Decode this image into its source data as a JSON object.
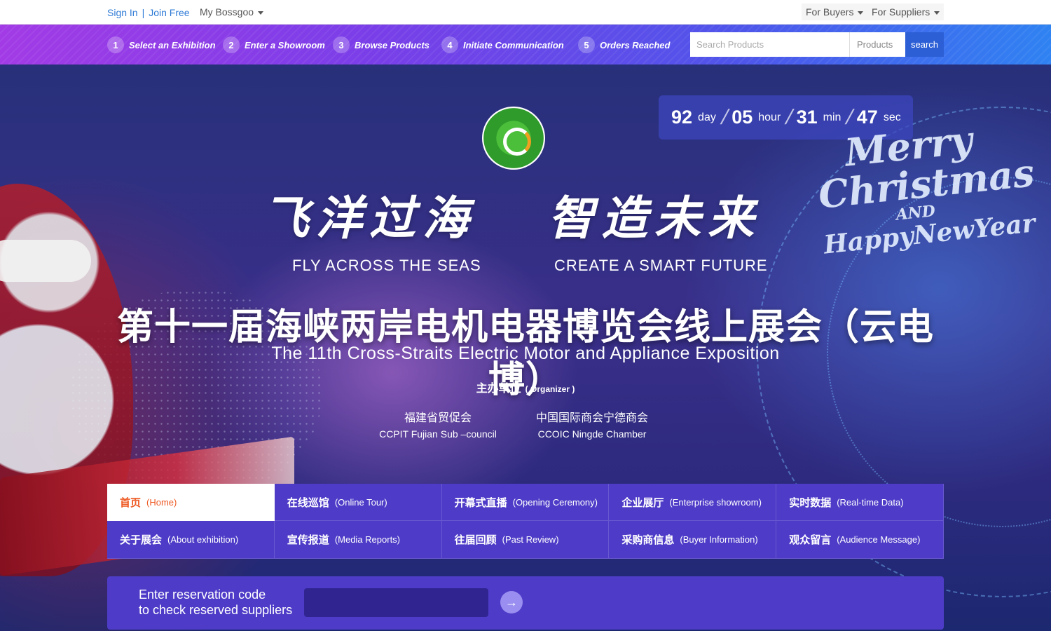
{
  "topbar": {
    "sign_in": "Sign In",
    "join_free": "Join Free",
    "my_bossgoo": "My Bossgoo",
    "for_buyers": "For Buyers",
    "for_suppliers": "For Suppliers"
  },
  "steps": [
    {
      "num": "1",
      "label": "Select an Exhibition"
    },
    {
      "num": "2",
      "label": "Enter a Showroom"
    },
    {
      "num": "3",
      "label": "Browse Products"
    },
    {
      "num": "4",
      "label": "Initiate Communication"
    },
    {
      "num": "5",
      "label": "Orders Reached"
    }
  ],
  "search": {
    "placeholder": "Search Products",
    "category": "Products",
    "button": "search"
  },
  "countdown": {
    "day": "92",
    "day_unit": "day",
    "hour": "05",
    "hour_unit": "hour",
    "min": "31",
    "min_unit": "min",
    "sec": "47",
    "sec_unit": "sec"
  },
  "hero": {
    "slogan_left_cn": "飞洋过海",
    "slogan_right_cn": "智造未来",
    "slogan_left_en": "FLY ACROSS THE SEAS",
    "slogan_right_en": "CREATE A SMART FUTURE",
    "merry_line1": "Merry Christmas",
    "merry_line2": "AND",
    "merry_line3": "HappyNewYear",
    "title_cn": "第十一届海峡两岸电机电器博览会线上展会（云电博）",
    "title_en": "The 11th Cross-Straits Electric Motor and Appliance Exposition",
    "organizer_cn": "主办单位",
    "organizer_en": "( Organizer )",
    "org1_cn": "福建省贸促会",
    "org1_en": "CCPIT Fujian Sub –council",
    "org2_cn": "中国国际商会宁德商会",
    "org2_en": "CCOIC Ningde Chamber"
  },
  "nav": [
    {
      "cn": "首页",
      "en": "(Home)"
    },
    {
      "cn": "在线巡馆",
      "en": "(Online Tour)"
    },
    {
      "cn": "开幕式直播",
      "en": "(Opening Ceremony)"
    },
    {
      "cn": "企业展厅",
      "en": "(Enterprise showroom)"
    },
    {
      "cn": "实时数据",
      "en": "(Real-time Data)"
    },
    {
      "cn": "关于展会",
      "en": "(About exhibition)"
    },
    {
      "cn": "宣传报道",
      "en": "(Media Reports)"
    },
    {
      "cn": "往届回顾",
      "en": "(Past Review)"
    },
    {
      "cn": "采购商信息",
      "en": "(Buyer Information)"
    },
    {
      "cn": "观众留言",
      "en": "(Audience Message)"
    }
  ],
  "reservation": {
    "line1": "Enter reservation code",
    "line2": "to check reserved suppliers",
    "value": ""
  },
  "colors": {
    "accent": "#4e3cc8",
    "active_text": "#ee5a24",
    "link": "#2f7bd6",
    "search_button": "#2c5fd6"
  },
  "icons": {
    "reservation_go": "arrow-right-icon",
    "dropdown": "caret-down-icon"
  }
}
